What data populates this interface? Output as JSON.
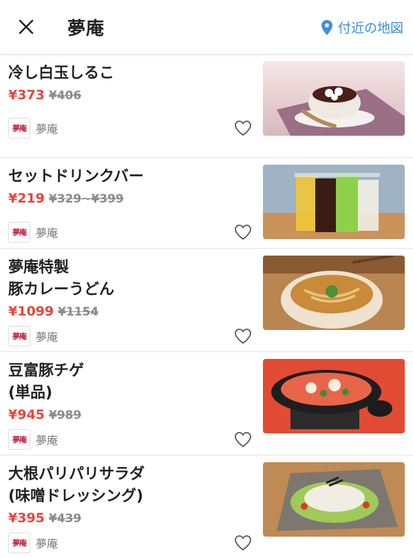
{
  "header": {
    "title": "夢庵",
    "map_label": "付近の地図",
    "accent_color": "#3d8ee0"
  },
  "items": [
    {
      "name": "冷し白玉しるこ",
      "price": "¥373",
      "original_price": "¥406",
      "shop_logo": "夢庵",
      "shop_name": "夢庵",
      "image": "shiratama-shiruko-image"
    },
    {
      "name": "セットドリンクバー",
      "price": "¥219",
      "original_price": "¥329~¥399",
      "shop_logo": "夢庵",
      "shop_name": "夢庵",
      "image": "drink-bar-image"
    },
    {
      "name": "夢庵特製\n豚カレーうどん",
      "price": "¥1099",
      "original_price": "¥1154",
      "shop_logo": "夢庵",
      "shop_name": "夢庵",
      "image": "curry-udon-image"
    },
    {
      "name": "豆富豚チゲ\n(単品)",
      "price": "¥945",
      "original_price": "¥989",
      "shop_logo": "夢庵",
      "shop_name": "夢庵",
      "image": "tofu-chige-image"
    },
    {
      "name": "大根パリパリサラダ\n(味噌ドレッシング)",
      "price": "¥395",
      "original_price": "¥439",
      "shop_logo": "夢庵",
      "shop_name": "夢庵",
      "image": "daikon-salad-image"
    }
  ],
  "colors": {
    "price": "#e8453c",
    "original_price": "#8a8a8a",
    "divider": "#e3e3e3"
  }
}
